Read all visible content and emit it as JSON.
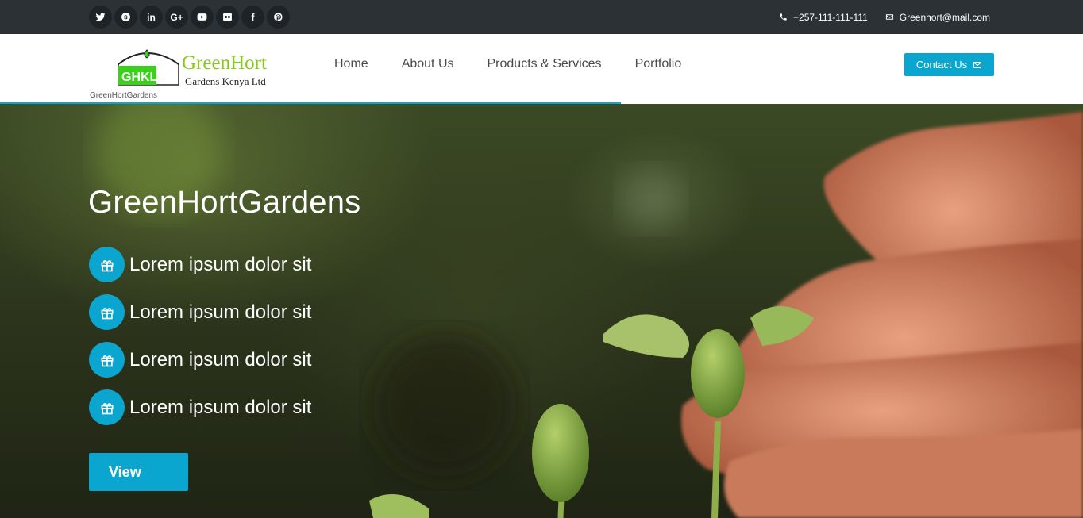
{
  "topbar": {
    "social": [
      {
        "name": "twitter-icon",
        "glyph": ""
      },
      {
        "name": "skype-icon",
        "glyph": ""
      },
      {
        "name": "linkedin-icon",
        "glyph": "in"
      },
      {
        "name": "google-plus-icon",
        "glyph": "G+"
      },
      {
        "name": "youtube-icon",
        "glyph": ""
      },
      {
        "name": "flickr-icon",
        "glyph": ""
      },
      {
        "name": "facebook-icon",
        "glyph": "f"
      },
      {
        "name": "pinterest-icon",
        "glyph": ""
      }
    ],
    "phone": "+257-111-111-111",
    "email": "Greenhort@mail.com"
  },
  "header": {
    "logo_badge": "GHKL",
    "logo_title": "GreenHort",
    "logo_subtitle": "Gardens Kenya Ltd",
    "logo_caption": "GreenHortGardens",
    "nav": [
      "Home",
      "About Us",
      "Products & Services",
      "Portfolio"
    ],
    "contact_button": "Contact Us"
  },
  "hero": {
    "title": "GreenHortGardens",
    "features": [
      "Lorem ipsum dolor sit",
      "Lorem ipsum dolor sit",
      "Lorem ipsum dolor sit",
      "Lorem ipsum dolor sit"
    ],
    "button": "View"
  },
  "colors": {
    "accent": "#0ba6cf",
    "topbar": "#2b3135",
    "logo_green": "#3bd01c"
  }
}
